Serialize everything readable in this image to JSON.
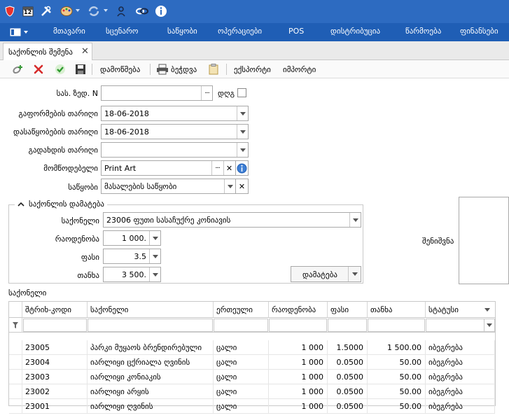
{
  "window": {
    "title_icons": [
      "shield-icon",
      "calendar-icon",
      "tools-icon",
      "palette-icon",
      "refresh-icon",
      "person-icon",
      "link-icon",
      "info-icon"
    ],
    "calendar_day": "12"
  },
  "menu": {
    "items": [
      "მთავარი",
      "სცენარო",
      "საწყობი",
      "ოპერაციები",
      "POS",
      "დისტრიბუცია",
      "წარმოება",
      "ფინანსები"
    ]
  },
  "tabs": [
    {
      "label": "საქონლის შემენა",
      "close": "✕"
    }
  ],
  "toolbar": {
    "approve_label": "დამოწმება",
    "print_label": "ბეჭდვა",
    "export_label": "ექსპორტი",
    "import_label": "იმპორტი"
  },
  "form": {
    "invoice_no_label": "სას. ზედ. N",
    "invoice_no_value": "",
    "vat_label": "დღგ",
    "issue_date_label": "გაფორმების თარიღი",
    "issue_date_value": "18-06-2018",
    "end_date_label": "დასაწყობების თარიღი",
    "end_date_value": "18-06-2018",
    "pay_date_label": "გადახდის თარიღი",
    "pay_date_value": "",
    "supplier_label": "მომწოდებელი",
    "supplier_value": "Print Art",
    "warehouse_label": "საწყობი",
    "warehouse_value": "მასალების საწყობი",
    "notes_label": "შენიშვნა"
  },
  "add_goods": {
    "title": "საქონლის დამატება",
    "product_label": "საქონელი",
    "product_value": "23006  ფუთი სასაჩუქრე კონიავის",
    "qty_label": "რაოდენობა",
    "qty_value": "1 000.",
    "price_label": "ფასი",
    "price_value": "3.5",
    "sum_label": "თანხა",
    "sum_value": "3 500.",
    "add_button": "დამატება"
  },
  "grid": {
    "section_label": "საქონელი",
    "columns": [
      "შტრიხ-კოდი",
      "საქონელი",
      "ერთეული",
      "რაოდენობა",
      "ფასი",
      "თანხა",
      "სტატუსი"
    ],
    "rows": [
      {
        "code": "23005",
        "name": "პარკი მუყაოს ბრენდირებული",
        "unit": "ცალი",
        "qty": "1 000",
        "price": "1.5000",
        "sum": "1 500.00",
        "status": "იბეგრება"
      },
      {
        "code": "23004",
        "name": "იარლიყი ცქრიალა ღვინის",
        "unit": "ცალი",
        "qty": "1 000",
        "price": "0.0500",
        "sum": "50.00",
        "status": "იბეგრება"
      },
      {
        "code": "23003",
        "name": "იარლიყი კონიაკის",
        "unit": "ცალი",
        "qty": "1 000",
        "price": "0.0500",
        "sum": "50.00",
        "status": "იბეგრება"
      },
      {
        "code": "23002",
        "name": "იარლიყი არყის",
        "unit": "ცალი",
        "qty": "1 000",
        "price": "0.0500",
        "sum": "50.00",
        "status": "იბეგრება"
      },
      {
        "code": "23001",
        "name": "იარლიყი ღვინის",
        "unit": "ცალი",
        "qty": "1 000",
        "price": "0.0500",
        "sum": "50.00",
        "status": "იბეგრება"
      }
    ]
  }
}
